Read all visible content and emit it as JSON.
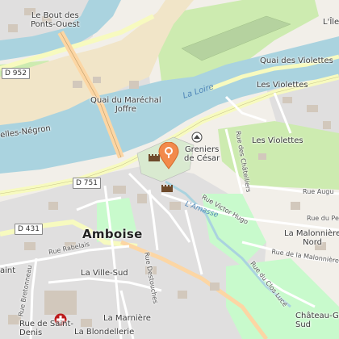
{
  "map": {
    "labels": {
      "le_bout_des_ponts_ouest": "Le Bout des\nPonts-Ouest",
      "quai_du_marechal_joffre": "Quai du Maréchal\nJoffre",
      "la_loire": "La Loire",
      "quai_des_violettes": "Quai des Violettes",
      "les_violettes_upper": "Les Violettes",
      "les_violettes_lower": "Les Violettes",
      "greniers_de_cesar": "Greniers\nde César",
      "rue_des_chatelliers": "Rue des Châtelliers",
      "rue_auguste": "Rue Augu",
      "rue_victor_hugo": "Rue Victor Hugo",
      "l_amasse": "L'Amasse",
      "rue_du_pe": "Rue du Pe",
      "la_malonniere_nord": "La Malonnière\nNord",
      "rue_de_la_malonniere": "Rue de la Malonnière",
      "rue_du_clos_luce": "Rue du Clos Lucé",
      "amboise": "Amboise",
      "rue_rabelais": "Rue Rabelais",
      "la_ville_sud": "La Ville-Sud",
      "rue_bretonneau": "Rue Bretonneau",
      "rue_de_saint_denis": "Rue de Saint-\nDenis",
      "la_marniere": "La Marnière",
      "la_blondellerie": "La Blondellerie",
      "chateau_gaillard_sud": "Château-Ga\nSud",
      "lile": "L'Île",
      "elles_negron": "elles-Négron",
      "saint_partial": "aint",
      "rue_destouches": "Rue Destouches"
    },
    "road_refs": {
      "d952": "D 952",
      "d751": "D 751",
      "d431": "D 431"
    },
    "icons": [
      "castle-icon",
      "viewpoint-icon",
      "hospital-icon",
      "location-marker-icon"
    ],
    "colors": {
      "water": "#aad3df",
      "river_sand": "#f1e5c8",
      "urban": "#e0dfdf",
      "park": "#c8facc",
      "grass": "#cdebb0",
      "primary_road": "#fcd6a4",
      "secondary_road": "#f7fabf",
      "marker": "#f28a4b"
    }
  }
}
